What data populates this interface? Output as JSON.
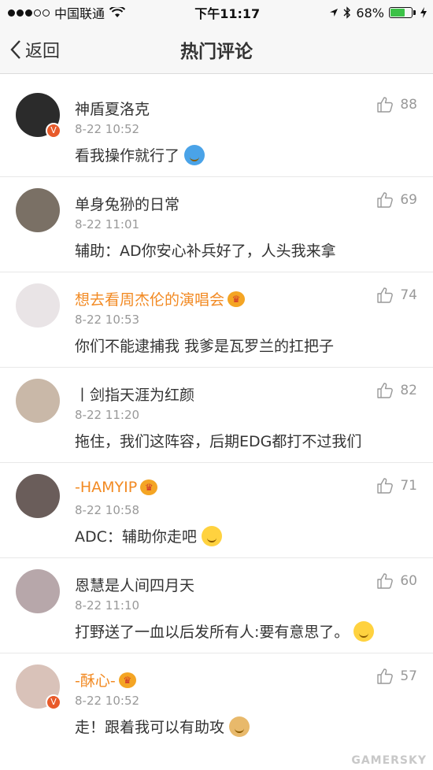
{
  "status_bar": {
    "carrier": "中国联通",
    "time": "下午11:17",
    "battery": "68%",
    "battery_level": 0.68
  },
  "nav": {
    "back_label": "返回",
    "title": "热门评论"
  },
  "comments": [
    {
      "name": "神盾夏洛克",
      "time": "8-22 10:52",
      "text": "看我操作就行了",
      "likes": "88",
      "avatar_color": "#2b2b2b",
      "verified": true,
      "vip": false,
      "emoji": "doraemon"
    },
    {
      "name": "单身兔狲的日常",
      "time": "8-22 11:01",
      "text": "辅助：AD你安心补兵好了，人头我来拿",
      "likes": "69",
      "avatar_color": "#7a7065",
      "verified": false,
      "vip": false,
      "emoji": ""
    },
    {
      "name": "想去看周杰伦的演唱会",
      "time": "8-22 10:53",
      "text": "你们不能逮捕我 我爹是瓦罗兰的扛把子",
      "likes": "74",
      "avatar_color": "#e9e4e6",
      "verified": false,
      "vip": true,
      "emoji": ""
    },
    {
      "name": "丨剑指天涯为红颜",
      "time": "8-22 11:20",
      "text": "拖住，我们这阵容，后期EDG都打不过我们",
      "likes": "82",
      "avatar_color": "#c9b8a8",
      "verified": false,
      "vip": false,
      "emoji": ""
    },
    {
      "name": "-HAMYIP",
      "time": "8-22 10:58",
      "text": "ADC：辅助你走吧",
      "likes": "71",
      "avatar_color": "#6a5d5a",
      "verified": false,
      "vip": true,
      "emoji": "thinking"
    },
    {
      "name": "恩慧是人间四月天",
      "time": "8-22 11:10",
      "text": "打野送了一血以后发所有人:要有意思了。",
      "likes": "60",
      "avatar_color": "#b7a7aa",
      "verified": false,
      "vip": false,
      "emoji": "smile"
    },
    {
      "name": "-酥心-",
      "time": "8-22 10:52",
      "text": "走！跟着我可以有助攻",
      "likes": "57",
      "avatar_color": "#d9c2b9",
      "verified": true,
      "vip": true,
      "emoji": "doge"
    }
  ],
  "watermark": "GAMERSKY"
}
